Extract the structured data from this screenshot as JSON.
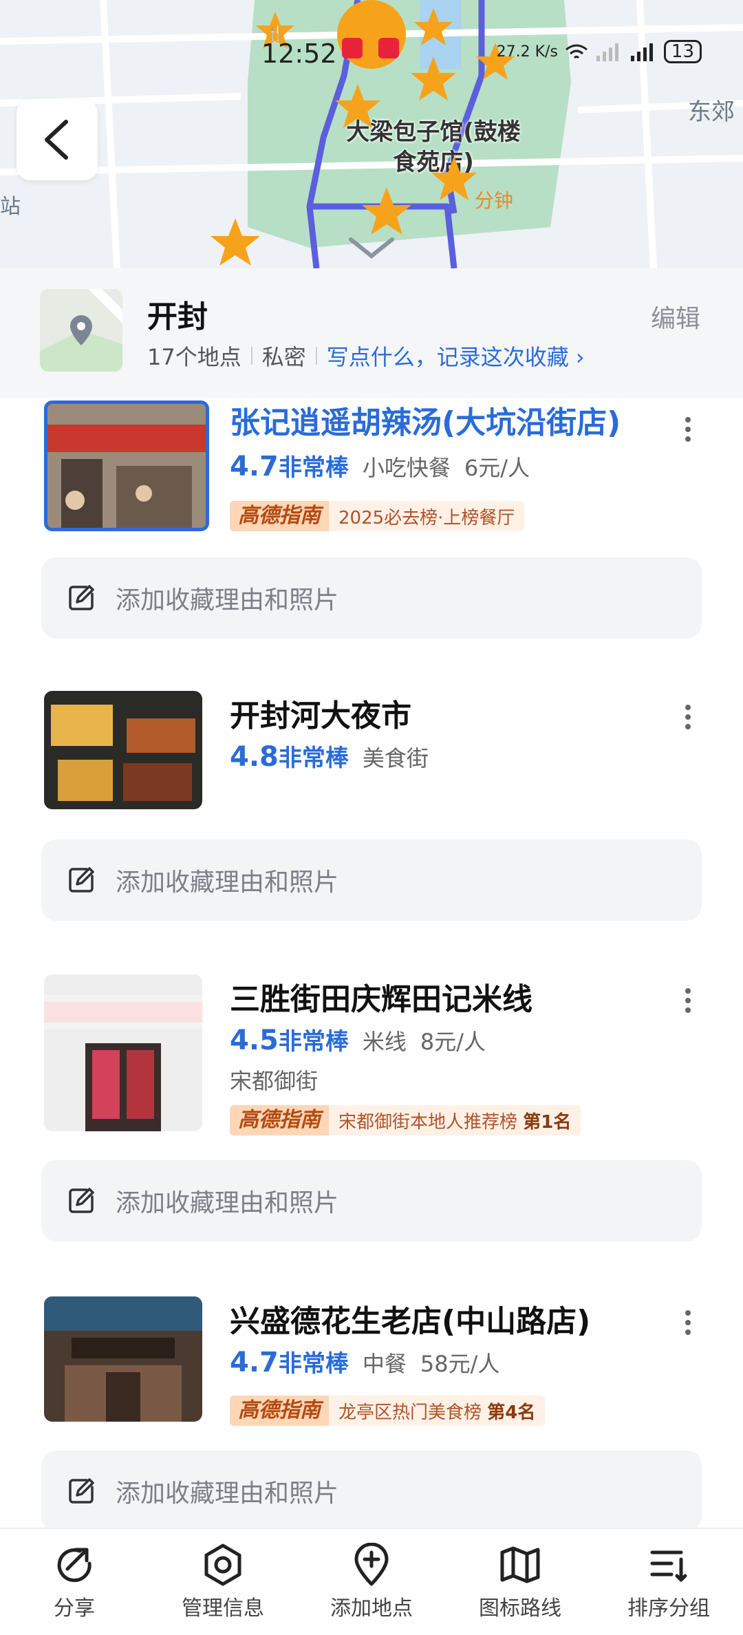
{
  "status_bar": {
    "time": "12:52",
    "net_speed": "27.2 K/s",
    "battery": "13"
  },
  "map": {
    "district_label": "东郊",
    "poi_title": "大梁包子馆(鼓楼食苑店)",
    "route_time": "分钟",
    "colors": {
      "park": "#b7dfc5",
      "route": "#5b5fdd",
      "pin": "#f7a21b"
    }
  },
  "collection": {
    "title": "开封",
    "count": "17个地点",
    "privacy": "私密",
    "note_link": "写点什么，记录这次收藏 ›",
    "edit": "编辑"
  },
  "items": [
    {
      "name": "张记逍遥胡辣汤(大坑沿街店)",
      "score": "4.7",
      "label": "非常棒",
      "category": "小吃快餐",
      "price": "6元/人",
      "badge_logo": "高德指南",
      "badge_text": "2025必去榜·上榜餐厅",
      "badge_rank": "",
      "add_text": "添加收藏理由和照片"
    },
    {
      "name": "开封河大夜市",
      "score": "4.8",
      "label": "非常棒",
      "category": "美食街",
      "add_text": "添加收藏理由和照片"
    },
    {
      "name": "三胜街田庆辉田记米线",
      "score": "4.5",
      "label": "非常棒",
      "category": "米线",
      "price": "8元/人",
      "area": "宋都御街",
      "badge_logo": "高德指南",
      "badge_text": "宋都御街本地人推荐榜",
      "badge_rank": "第1名",
      "add_text": "添加收藏理由和照片"
    },
    {
      "name": "兴盛德花生老店(中山路店)",
      "score": "4.7",
      "label": "非常棒",
      "category": "中餐",
      "price": "58元/人",
      "badge_logo": "高德指南",
      "badge_text": "龙亭区热门美食榜",
      "badge_rank": "第4名",
      "add_text": "添加收藏理由和照片"
    }
  ],
  "bottom_nav": [
    {
      "label": "分享",
      "icon": "share-icon"
    },
    {
      "label": "管理信息",
      "icon": "manage-icon"
    },
    {
      "label": "添加地点",
      "icon": "add-location-icon"
    },
    {
      "label": "图标路线",
      "icon": "map-route-icon"
    },
    {
      "label": "排序分组",
      "icon": "sort-icon"
    }
  ]
}
